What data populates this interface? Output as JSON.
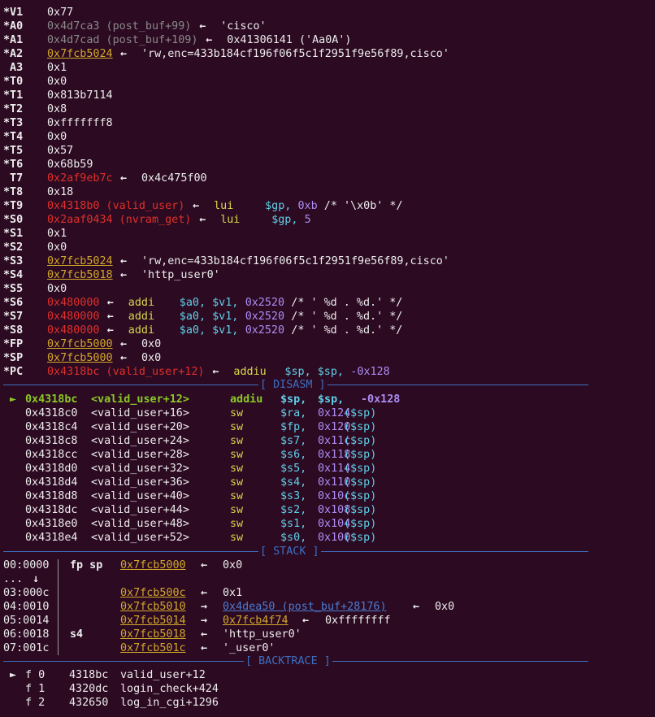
{
  "registers": [
    {
      "name": "*V1",
      "value": "0x77"
    },
    {
      "name": "*A0",
      "value": "0x4d7ca3 (post_buf+99)",
      "arrow": "←",
      "target": "'cisco'"
    },
    {
      "name": "*A1",
      "value": "0x4d7cad (post_buf+109)",
      "arrow": "←",
      "target": "0x41306141 ('Aa0A')"
    },
    {
      "name": "*A2",
      "value": "0x7fcb5024",
      "arrow": "←",
      "target": "'rw,enc=433b184cf196f06f5c1f2951f9e56f89,cisco'"
    },
    {
      "name": " A3",
      "value": "0x1"
    },
    {
      "name": "*T0",
      "value": "0x0"
    },
    {
      "name": "*T1",
      "value": "0x813b7114"
    },
    {
      "name": "*T2",
      "value": "0x8"
    },
    {
      "name": "*T3",
      "value": "0xfffffff8"
    },
    {
      "name": "*T4",
      "value": "0x0"
    },
    {
      "name": "*T5",
      "value": "0x57"
    },
    {
      "name": "*T6",
      "value": "0x68b59"
    },
    {
      "name": " T7",
      "value": "0x2af9eb7c",
      "arrow": "←",
      "target": "0x4c475f00"
    },
    {
      "name": "*T8",
      "value": "0x18"
    },
    {
      "name": "*T9",
      "value": "0x4318b0 (valid_user)",
      "arrow": "←",
      "mnemonic": "lui",
      "ops1": "$gp,",
      "ops2": "0xb",
      "comment": "/* '\\x0b' */"
    },
    {
      "name": "*S0",
      "value": "0x2aaf0434 (nvram_get)",
      "arrow": "←",
      "mnemonic": "lui",
      "ops1": "$gp,",
      "ops2": "5"
    },
    {
      "name": "*S1",
      "value": "0x1"
    },
    {
      "name": "*S2",
      "value": "0x0"
    },
    {
      "name": "*S3",
      "value": "0x7fcb5024",
      "arrow": "←",
      "target": "'rw,enc=433b184cf196f06f5c1f2951f9e56f89,cisco'"
    },
    {
      "name": "*S4",
      "value": "0x7fcb5018",
      "arrow": "←",
      "target": "'http_user0'"
    },
    {
      "name": "*S5",
      "value": "0x0"
    },
    {
      "name": "*S6",
      "value": "0x480000",
      "arrow": "←",
      "mnemonic": "addi",
      "ops1": "$a0, $v1,",
      "ops2": "0x2520",
      "comment": "/* ' %d . %d.' */"
    },
    {
      "name": "*S7",
      "value": "0x480000",
      "arrow": "←",
      "mnemonic": "addi",
      "ops1": "$a0, $v1,",
      "ops2": "0x2520",
      "comment": "/* ' %d . %d.' */"
    },
    {
      "name": "*S8",
      "value": "0x480000",
      "arrow": "←",
      "mnemonic": "addi",
      "ops1": "$a0, $v1,",
      "ops2": "0x2520",
      "comment": "/* ' %d . %d.' */"
    },
    {
      "name": "*FP",
      "value": "0x7fcb5000",
      "arrow": "←",
      "target": "0x0"
    },
    {
      "name": "*SP",
      "value": "0x7fcb5000",
      "arrow": "←",
      "target": "0x0"
    },
    {
      "name": "*PC",
      "value": "0x4318bc (valid_user+12)",
      "arrow": "←",
      "mnemonic": "addiu",
      "ops1": "$sp, $sp,",
      "ops2": "-0x128"
    }
  ],
  "sections": {
    "disasm": "[ DISASM ]",
    "stack": "[ STACK ]",
    "backtrace": "[ BACKTRACE ]"
  },
  "disasm": [
    {
      "cur": true,
      "marker": "►",
      "addr": "0x4318bc",
      "sym": "<valid_user+12>",
      "mn": "addiu",
      "r1": "$sp,",
      "r2": "$sp,",
      "imm": "-0x128",
      "base": ""
    },
    {
      "addr": "0x4318c0",
      "sym": "<valid_user+16>",
      "mn": "sw",
      "r1": "$ra,",
      "imm": "0x124",
      "base": "($sp)"
    },
    {
      "addr": "0x4318c4",
      "sym": "<valid_user+20>",
      "mn": "sw",
      "r1": "$fp,",
      "imm": "0x120",
      "base": "($sp)"
    },
    {
      "addr": "0x4318c8",
      "sym": "<valid_user+24>",
      "mn": "sw",
      "r1": "$s7,",
      "imm": "0x11c",
      "base": "($sp)"
    },
    {
      "addr": "0x4318cc",
      "sym": "<valid_user+28>",
      "mn": "sw",
      "r1": "$s6,",
      "imm": "0x118",
      "base": "($sp)"
    },
    {
      "addr": "0x4318d0",
      "sym": "<valid_user+32>",
      "mn": "sw",
      "r1": "$s5,",
      "imm": "0x114",
      "base": "($sp)"
    },
    {
      "addr": "0x4318d4",
      "sym": "<valid_user+36>",
      "mn": "sw",
      "r1": "$s4,",
      "imm": "0x110",
      "base": "($sp)"
    },
    {
      "addr": "0x4318d8",
      "sym": "<valid_user+40>",
      "mn": "sw",
      "r1": "$s3,",
      "imm": "0x10c",
      "base": "($sp)"
    },
    {
      "addr": "0x4318dc",
      "sym": "<valid_user+44>",
      "mn": "sw",
      "r1": "$s2,",
      "imm": "0x108",
      "base": "($sp)"
    },
    {
      "addr": "0x4318e0",
      "sym": "<valid_user+48>",
      "mn": "sw",
      "r1": "$s1,",
      "imm": "0x104",
      "base": "($sp)"
    },
    {
      "addr": "0x4318e4",
      "sym": "<valid_user+52>",
      "mn": "sw",
      "r1": "$s0,",
      "imm": "0x100",
      "base": "($sp)"
    }
  ],
  "stack": [
    {
      "off": "00:0000",
      "tag": "fp sp",
      "addr": "0x7fcb5000",
      "arrow": "←",
      "val": "0x0"
    },
    {
      "off": "...",
      "tag": "",
      "addr": "",
      "arrow": "↓",
      "val": ""
    },
    {
      "off": "03:000c",
      "tag": "",
      "addr": "0x7fcb500c",
      "arrow": "←",
      "val": "0x1"
    },
    {
      "off": "04:0010",
      "tag": "",
      "addr": "0x7fcb5010",
      "arrow": "→",
      "ptr": "0x4dea50 (post_buf+28176)",
      "arrow2": "←",
      "val": "0x0"
    },
    {
      "off": "05:0014",
      "tag": "",
      "addr": "0x7fcb5014",
      "arrow": "→",
      "ptr2": "0x7fcb4f74",
      "arrow2": "←",
      "val": "0xffffffff"
    },
    {
      "off": "06:0018",
      "tag": "s4",
      "addr": "0x7fcb5018",
      "arrow": "←",
      "val": "'http_user0'"
    },
    {
      "off": "07:001c",
      "tag": "",
      "addr": "0x7fcb501c",
      "arrow": "←",
      "val": "'_user0'"
    }
  ],
  "backtrace": [
    {
      "marker": "►",
      "frame": "f 0",
      "addr": "4318bc",
      "sym": "valid_user+12"
    },
    {
      "marker": "",
      "frame": "f 1",
      "addr": "4320dc",
      "sym": "login_check+424"
    },
    {
      "marker": "",
      "frame": "f 2",
      "addr": "432650",
      "sym": "log_in_cgi+1296"
    }
  ]
}
